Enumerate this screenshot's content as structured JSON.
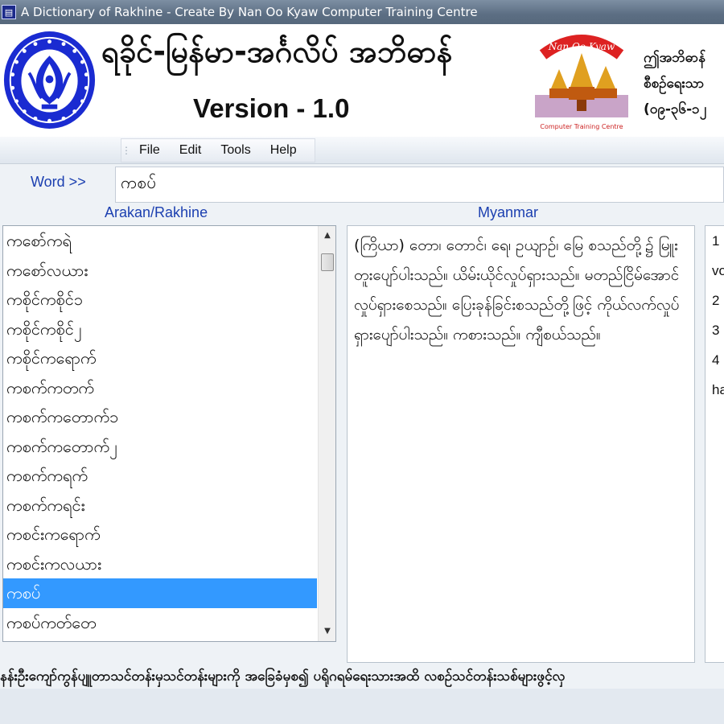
{
  "window": {
    "title": "A Dictionary of Rakhine - Create By Nan Oo Kyaw Computer Training Centre",
    "app_icon": "dictionary-app-icon"
  },
  "header": {
    "title": "ရခိုင်-မြန်မာ-အင်္ဂလိပ် အဘိဓာန်",
    "version": "Version - 1.0",
    "logo_banner": "Nan Oo Kyaw",
    "logo_caption": "Computer Training Centre",
    "contact_lines": [
      "ဤအဘိဓာန်",
      "စီစဉ်ရေးသာ",
      "(၀၉-၃၆-၁၂"
    ]
  },
  "menu": [
    "File",
    "Edit",
    "Tools",
    "Help"
  ],
  "search": {
    "label": "Word >>",
    "value": "ကစပ်"
  },
  "columns": {
    "left": "Arakan/Rakhine",
    "middle": "Myanmar"
  },
  "word_list": {
    "items": [
      "ကစော်ကရဲ",
      "ကစော်လယား",
      "ကစိုင်ကစိုင်၁",
      "ကစိုင်ကစိုင်၂",
      "ကစိုင်ကရောက်",
      "ကစက်ကတက်",
      "ကစက်ကတောက်၁",
      "ကစက်ကတောက်၂",
      "ကစက်ကရက်",
      "ကစက်ကရင်း",
      "ကစင်းကရောက်",
      "ကစင်းကလယား",
      "ကစပ်",
      "ကစပ်ကတ်တေ"
    ],
    "selected_index": 12
  },
  "definition": "(ကြိယာ)   တော၊ တောင်၊ ရေ၊ ဥယျာဉ်၊ မြေ စသည်တို့၌ မြူးတူးပျော်ပါးသည်။ ယိမ်းယိုင်လှုပ်ရှားသည်။ မတည်ငြိမ်အောင် လှုပ်ရှားစေသည်။ ပြေးခုန်ခြင်းစသည်တို့ဖြင့် ကိုယ်လက်လှုပ်ရှားပျော်ပါးသည်။ ကစားသည်။ ကျီစယ်သည်။",
  "english_panel": [
    "1",
    "vo",
    "2",
    "3",
    "4",
    "ha"
  ],
  "marquee": "နန်းဦးကျော်ကွန်ပျူတာသင်တန်းမှသင်တန်းများကို အခြေခံမှစ၍ ပရိုဂရမ်ရေးသားအထိ လစဉ်သင်တန်းသစ်များဖွင့်လှ",
  "colors": {
    "selection": "#3399ff",
    "label_blue": "#1b3fb0",
    "seal_blue": "#1a2bd1"
  }
}
